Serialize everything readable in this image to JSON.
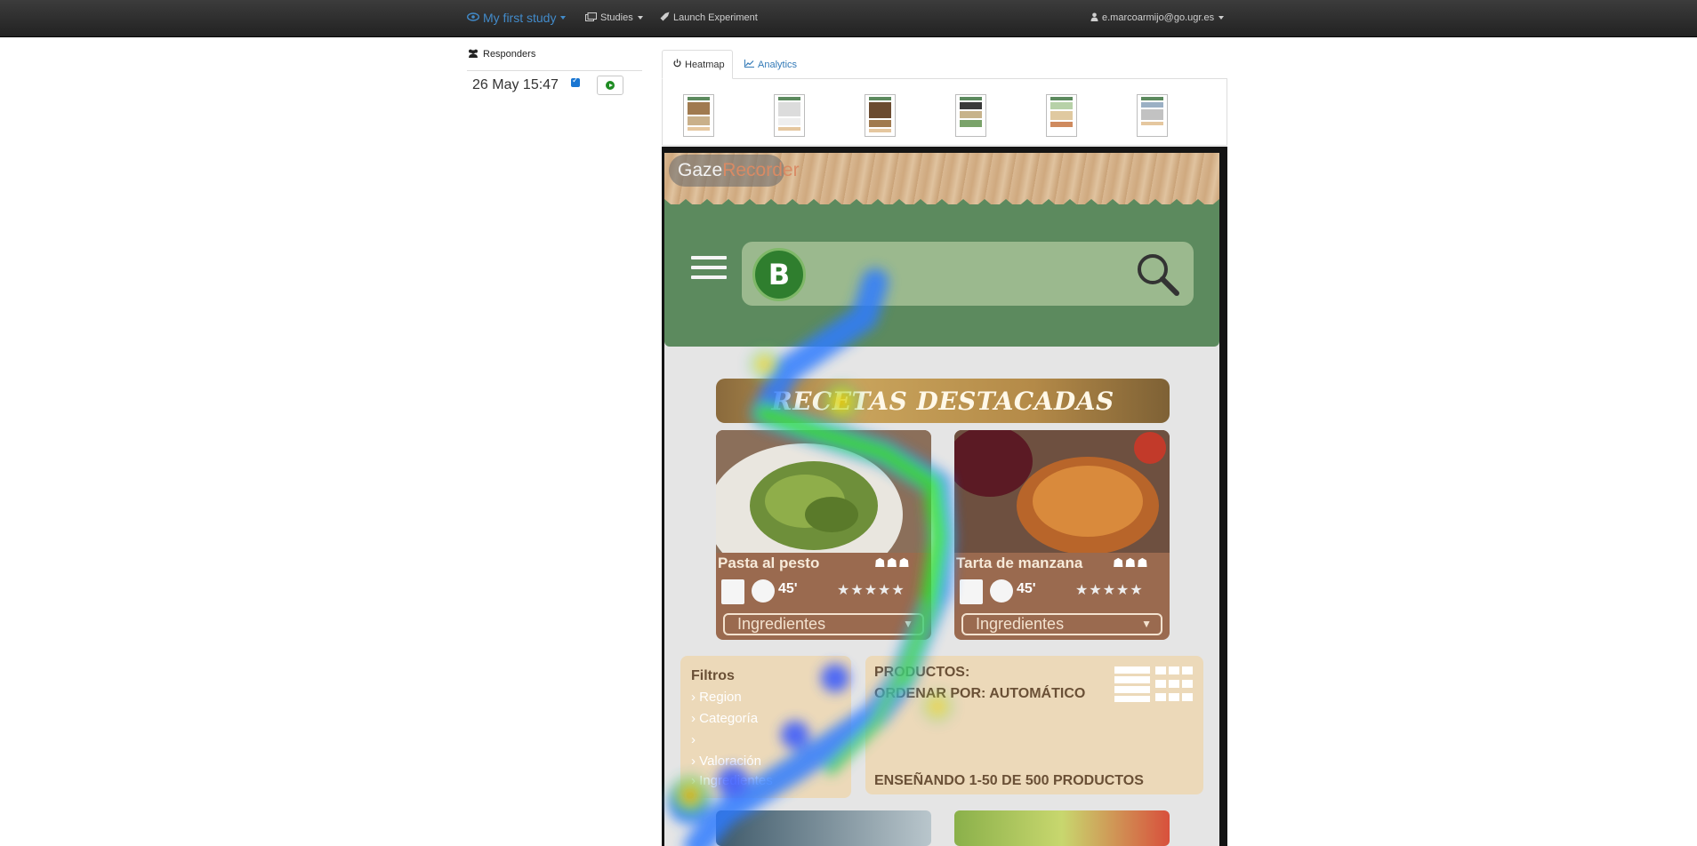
{
  "navbar": {
    "brand": "My first study",
    "studies": "Studies",
    "launch": "Launch Experiment",
    "user": "e.marcoarmijo@go.ugr.es"
  },
  "sidebar": {
    "title": "Responders",
    "responders": [
      {
        "date": "26 May 15:47",
        "checked": true
      }
    ]
  },
  "tabs": {
    "heatmap": "Heatmap",
    "analytics": "Analytics"
  },
  "site": {
    "overlay_gaze": "Gaze",
    "overlay_recorder": "Recorder",
    "logo_letter": "B",
    "banner": "RECETAS DESTACADAS",
    "cards": [
      {
        "title": "Pasta al pesto",
        "time": "45'",
        "dropdown": "Ingredientes"
      },
      {
        "title": "Tarta de manzana",
        "time": "45'",
        "dropdown": "Ingredientes"
      }
    ],
    "filters": {
      "title": "Filtros",
      "items": [
        "Region",
        "Categoría",
        "",
        "Valoración",
        "Ingredientes"
      ]
    },
    "products": {
      "label": "PRODUCTOS:",
      "sort": "ORDENAR POR: AUTOMÁTICO",
      "showing": "ENSEÑANDO 1-50 DE 500 PRODUCTOS"
    }
  },
  "colors": {
    "brand": "#428bca",
    "header_green": "#5c8a5e",
    "card_brown": "#9a6a4f",
    "panel_beige": "#ecd9b9"
  }
}
